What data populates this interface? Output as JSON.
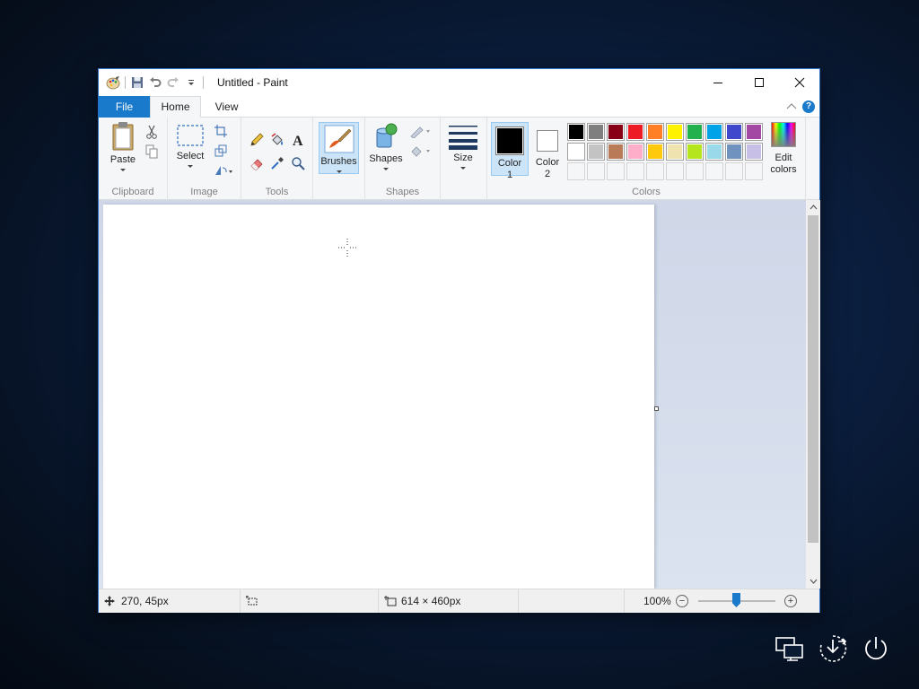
{
  "window": {
    "title": "Untitled - Paint"
  },
  "tabs": {
    "file": "File",
    "home": "Home",
    "view": "View"
  },
  "clipboard": {
    "paste": "Paste",
    "group": "Clipboard"
  },
  "image": {
    "select": "Select",
    "group": "Image"
  },
  "tools": {
    "group": "Tools"
  },
  "brushes": {
    "label": "Brushes"
  },
  "shapes": {
    "label": "Shapes",
    "group": "Shapes"
  },
  "size": {
    "label": "Size"
  },
  "colors": {
    "color1_line1": "Color",
    "color1_line2": "1",
    "color2_line1": "Color",
    "color2_line2": "2",
    "edit_line1": "Edit",
    "edit_line2": "colors",
    "group": "Colors",
    "color1_value": "#000000",
    "color2_value": "#ffffff",
    "row1": [
      "#000000",
      "#7f7f7f",
      "#880015",
      "#ed1c24",
      "#ff7f27",
      "#fff200",
      "#22b14c",
      "#00a2e8",
      "#3f48cc",
      "#a349a4"
    ],
    "row2": [
      "#ffffff",
      "#c3c3c3",
      "#b97a57",
      "#ffaec9",
      "#ffc90e",
      "#efe4b0",
      "#b5e61d",
      "#99d9ea",
      "#7092be",
      "#c8bfe7"
    ]
  },
  "status": {
    "cursor_pos": "270, 45px",
    "canvas_size": "614 × 460px",
    "zoom": "100%"
  }
}
